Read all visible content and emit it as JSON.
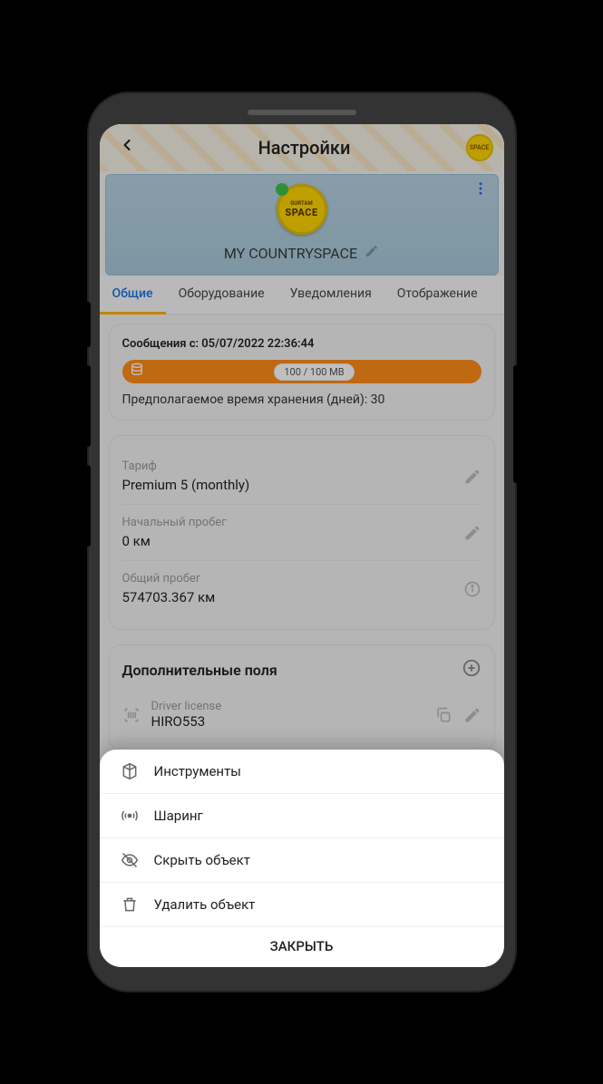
{
  "brand": {
    "small": "GURTAM",
    "big": "SPACE"
  },
  "header": {
    "title": "Настройки"
  },
  "workspace": {
    "name": "MY COUNTRYSPACE"
  },
  "tabs": {
    "general": "Общие",
    "equipment": "Оборудование",
    "notifications": "Уведомления",
    "display": "Отображение"
  },
  "storage": {
    "since_label": "Сообщения с: 05/07/2022 22:36:44",
    "usage": "100 / 100 MB",
    "retention": "Предполагаемое время хранения (дней): 30"
  },
  "tariff": {
    "label": "Тариф",
    "value": "Premium 5 (monthly)"
  },
  "initial_mileage": {
    "label": "Начальный пробег",
    "value": "0 км"
  },
  "total_mileage": {
    "label": "Общий пробег",
    "value": "574703.367 км"
  },
  "custom_fields": {
    "title": "Дополнительные поля",
    "items": [
      {
        "label": "Driver license",
        "value": "HIRO553"
      }
    ]
  },
  "sheet": {
    "tools": "Инструменты",
    "sharing": "Шаринг",
    "hide": "Скрыть объект",
    "delete": "Удалить объект",
    "close": "ЗАКРЫТЬ"
  }
}
